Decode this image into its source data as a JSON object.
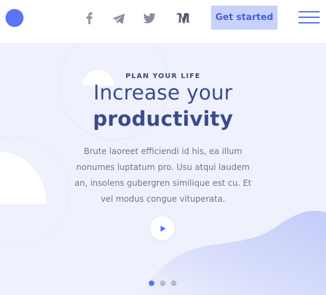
{
  "header": {
    "logo": "logo",
    "social": [
      {
        "name": "facebook",
        "icon": "facebook-icon"
      },
      {
        "name": "telegram",
        "icon": "telegram-icon"
      },
      {
        "name": "twitter",
        "icon": "twitter-icon"
      },
      {
        "name": "medium",
        "icon": "medium-icon"
      }
    ],
    "cta_label": "Get started",
    "menu_icon": "hamburger-icon"
  },
  "hero": {
    "eyebrow": "PLAN YOUR LIFE",
    "title_line1": "Increase your",
    "title_line2": "productivity",
    "description": "Brute laoreet efficiendi id his, ea illum nonumes luptatum pro. Usu atqui laudem an, insolens gubergren similique est cu. Et vel modus congue vituperata.",
    "play_icon": "play-icon",
    "slides_total": 3,
    "active_slide": 1
  },
  "colors": {
    "accent": "#5b74f4",
    "button_bg": "#c7d2fb",
    "hero_bg": "#eff2fd",
    "heading": "#3b4a8c",
    "text": "#6d7790"
  }
}
